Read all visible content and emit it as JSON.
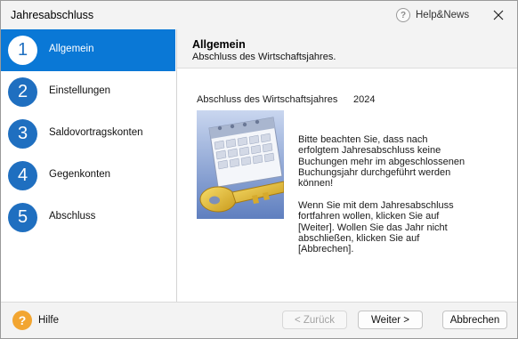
{
  "window": {
    "title": "Jahresabschluss",
    "help_link": "Help&News",
    "help_glyph": "?",
    "close_glyph": "✕"
  },
  "sidebar": {
    "active_color": "#0a78d6",
    "circle_color": "#1f6fc0",
    "steps": [
      {
        "number": "1",
        "label": "Allgemein",
        "active": true
      },
      {
        "number": "2",
        "label": "Einstellungen",
        "active": false
      },
      {
        "number": "3",
        "label": "Saldovortragskonten",
        "active": false
      },
      {
        "number": "4",
        "label": "Gegenkonten",
        "active": false
      },
      {
        "number": "5",
        "label": "Abschluss",
        "active": false
      }
    ]
  },
  "main": {
    "heading": "Allgemein",
    "subheading": "Abschluss des Wirtschaftsjahres.",
    "year_label": "Abschluss des Wirtschaftsjahres",
    "year_value": "2024",
    "info_paragraph_1": "Bitte beachten Sie, dass nach\nerfolgtem Jahresabschluss keine\nBuchungen mehr im abgeschlossenen\nBuchungsjahr durchgeführt werden\nkönnen!",
    "info_paragraph_2": "Wenn Sie mit dem Jahresabschluss\nfortfahren wollen, klicken Sie auf\n[Weiter]. Wollen Sie das Jahr nicht\nabschließen, klicken Sie auf\n[Abbrechen].",
    "illustration_icon": "calendar-key-icon"
  },
  "footer": {
    "help_label": "Hilfe",
    "help_glyph": "?",
    "back_label": "< Zurück",
    "next_label": "Weiter >",
    "cancel_label": "Abbrechen"
  }
}
